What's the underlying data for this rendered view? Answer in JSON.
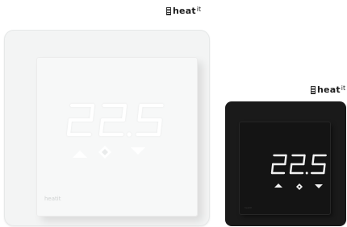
{
  "brand": {
    "name": "heat",
    "suffix": "it"
  },
  "thermostat_white": {
    "temperature": "22.5",
    "face_brand": "heatit"
  },
  "thermostat_black": {
    "temperature": "22.5",
    "face_brand": "heatit"
  },
  "colors": {
    "white_unit_frame": "#f3f4f4",
    "white_unit_digits": "#ffffff",
    "black_unit_frame": "#1a1a1a",
    "black_unit_digits": "#f2f2f2"
  },
  "icons": [
    "up-arrow-icon",
    "mode-diamond-icon",
    "down-arrow-icon"
  ]
}
